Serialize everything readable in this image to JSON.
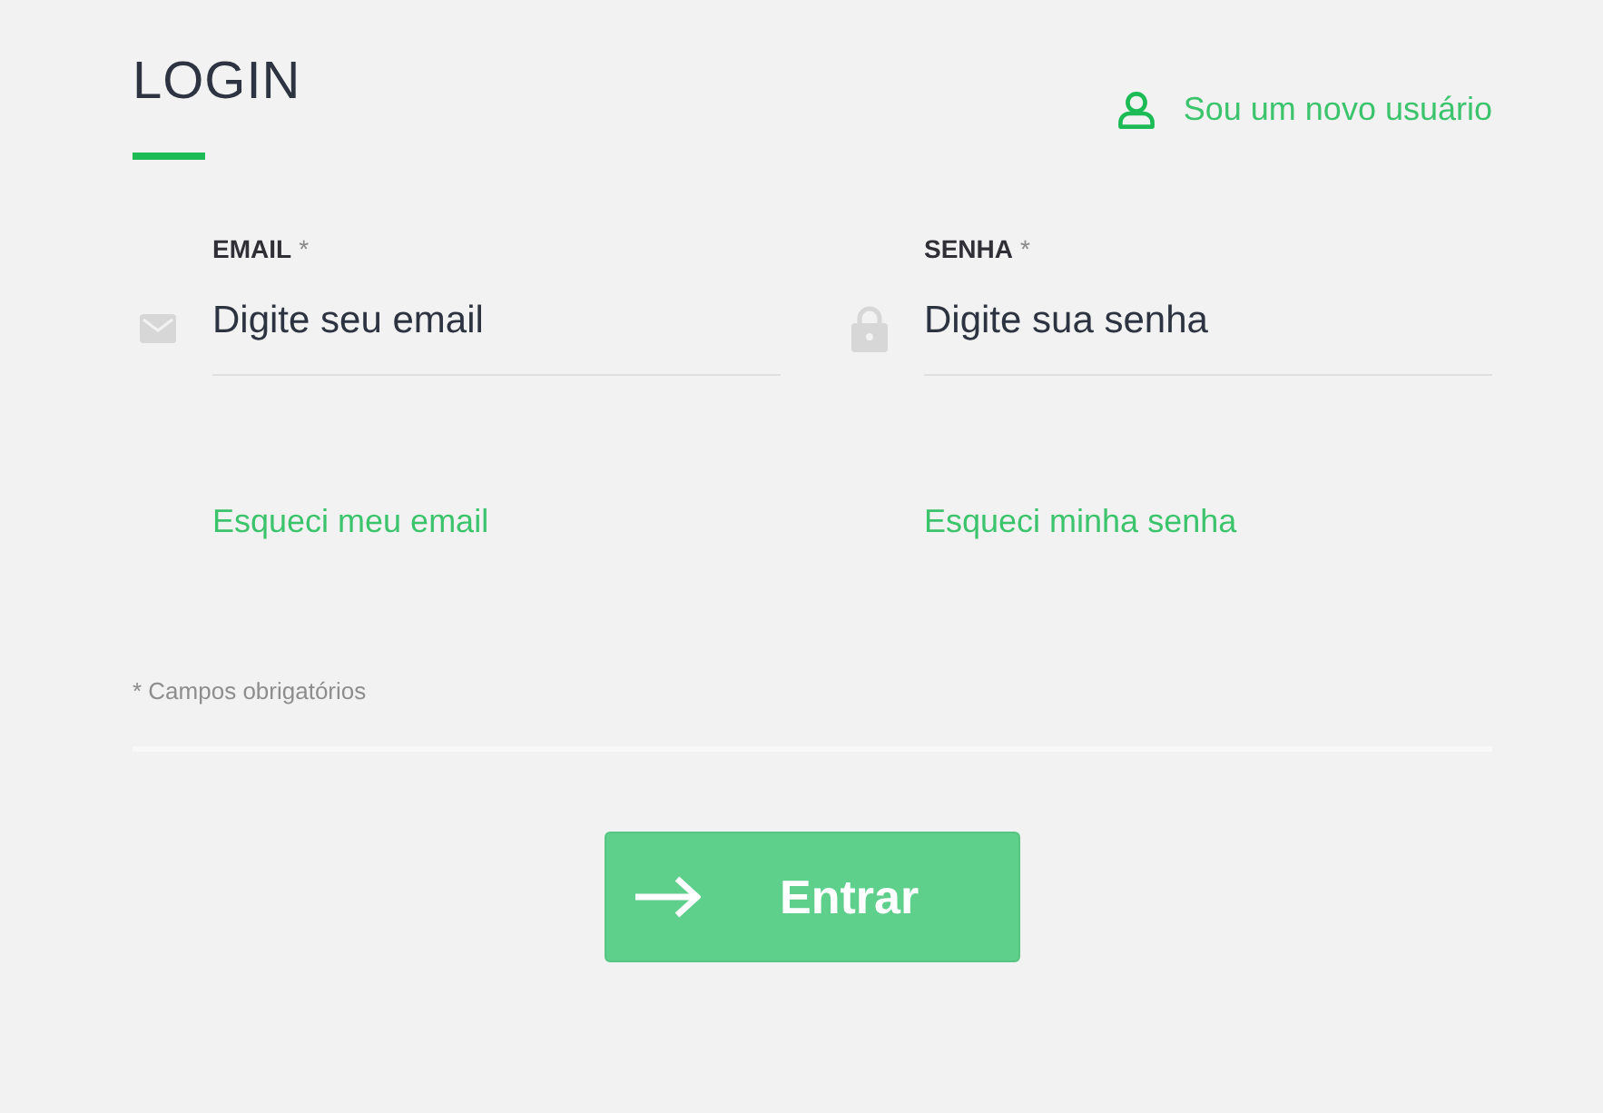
{
  "header": {
    "title": "LOGIN",
    "new_user_link": "Sou um novo usuário"
  },
  "fields": [
    {
      "kind": "email",
      "label": "EMAIL",
      "required_mark": "*",
      "placeholder": "Digite seu email",
      "forgot_link": "Esqueci meu email"
    },
    {
      "kind": "password",
      "label": "SENHA",
      "required_mark": "*",
      "placeholder": "Digite sua senha",
      "forgot_link": "Esqueci minha senha"
    }
  ],
  "required_note": "* Campos obrigatórios",
  "submit_button": {
    "label": "Entrar"
  }
}
